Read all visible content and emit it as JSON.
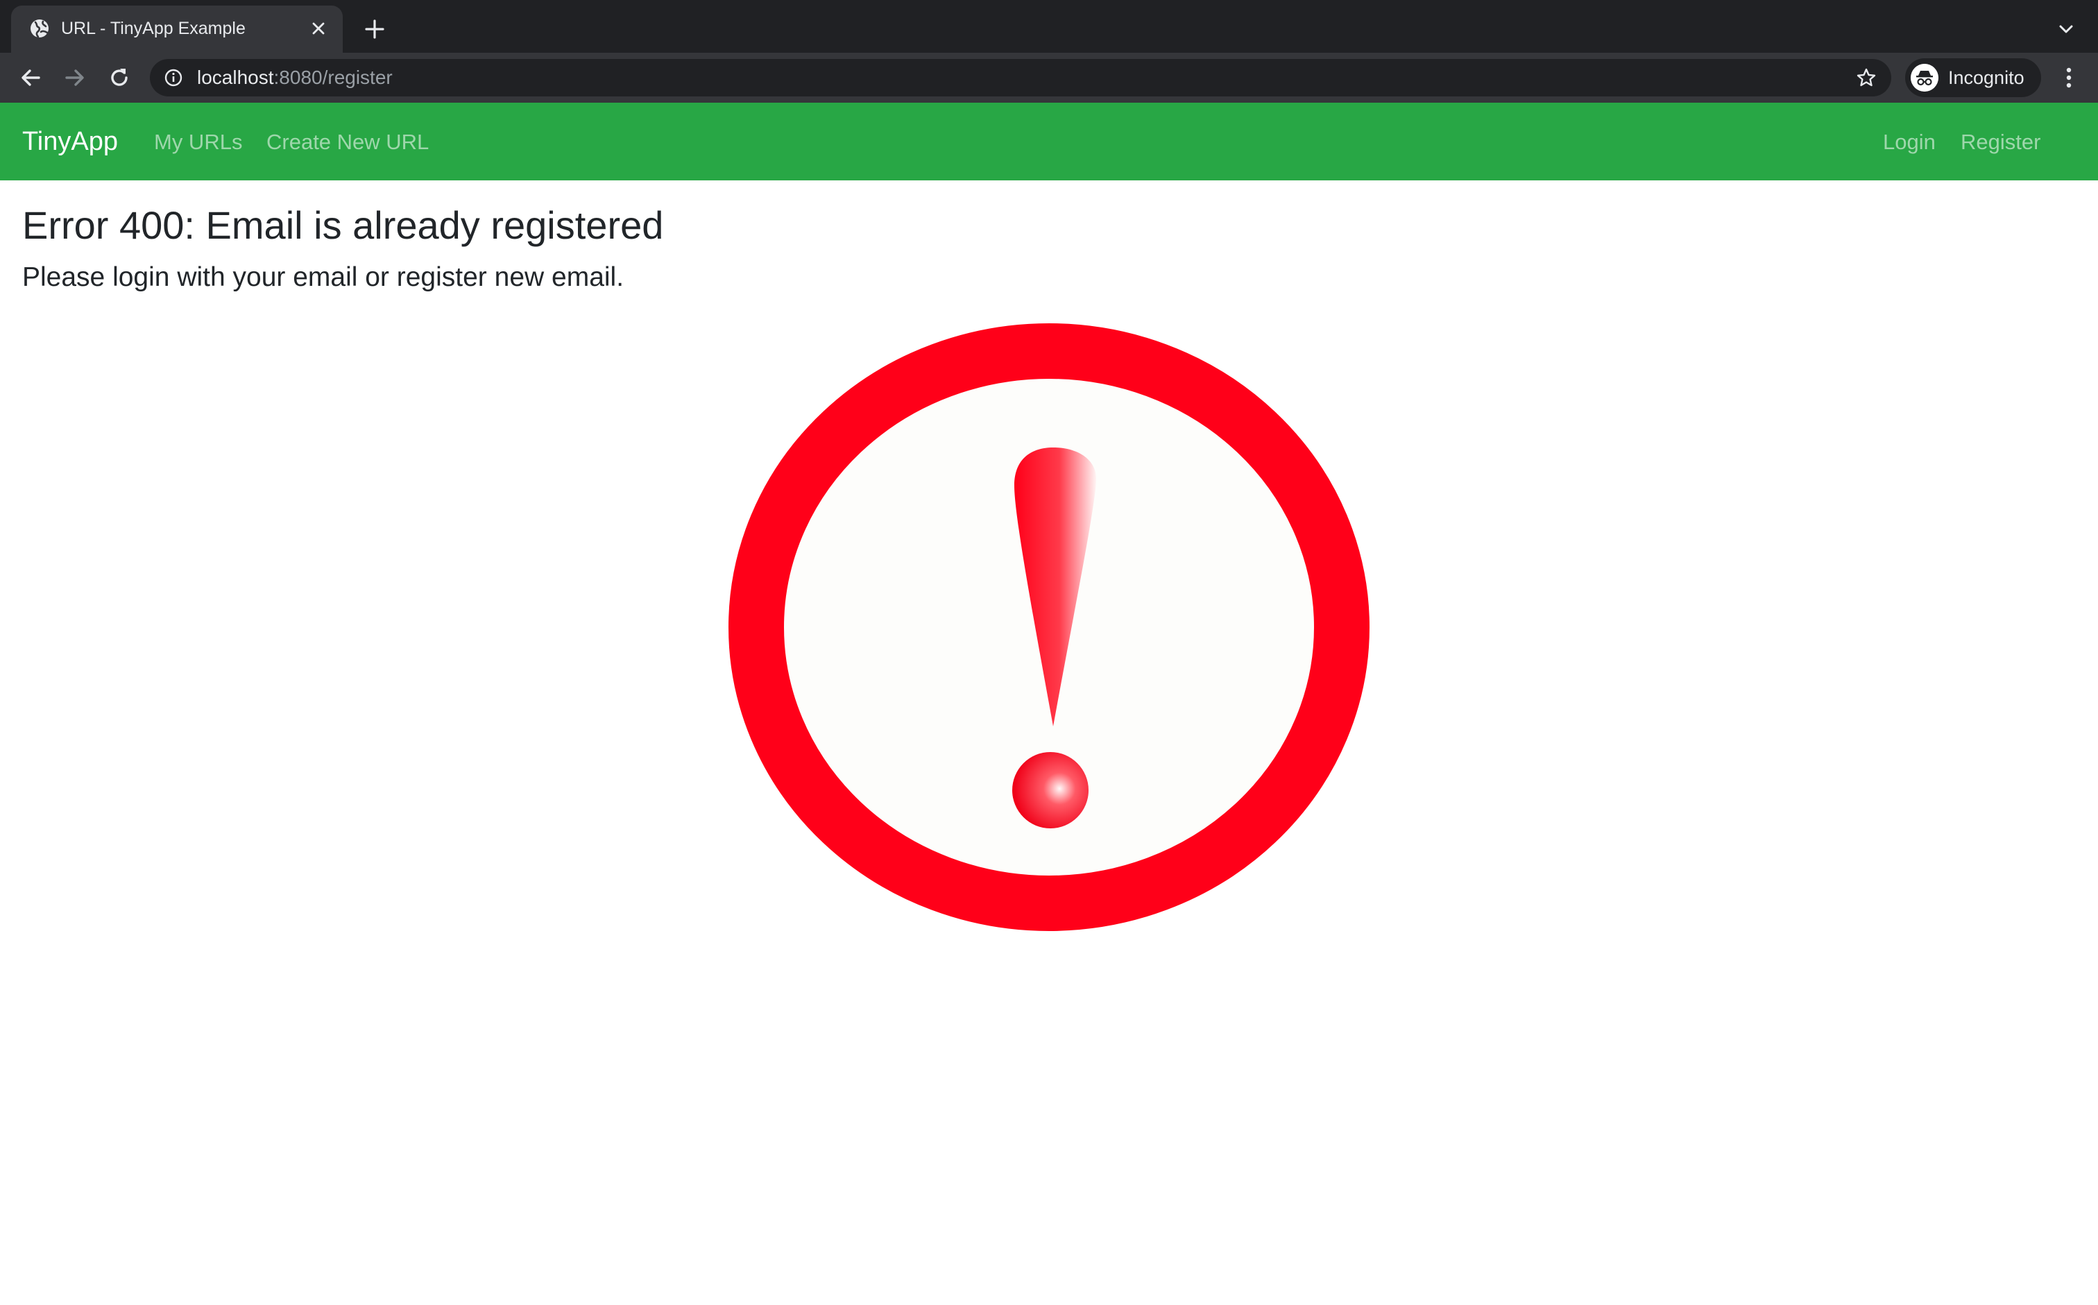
{
  "browser": {
    "tab": {
      "title": "URL - TinyApp Example",
      "favicon": "globe-icon"
    },
    "address_bar": {
      "host": "localhost",
      "rest": ":8080/register",
      "info_icon": "info-icon",
      "bookmark_icon": "star-icon"
    },
    "profile_label": "Incognito"
  },
  "navbar": {
    "brand": "TinyApp",
    "left_links": [
      "My URLs",
      "Create New URL"
    ],
    "right_links": [
      "Login",
      "Register"
    ],
    "color": "#28a745"
  },
  "content": {
    "title": "Error 400: Email is already registered",
    "subtitle": "Please login with your email or register new email.",
    "graphic": "exclamation-warning-icon",
    "graphic_color": "#ff0019"
  }
}
